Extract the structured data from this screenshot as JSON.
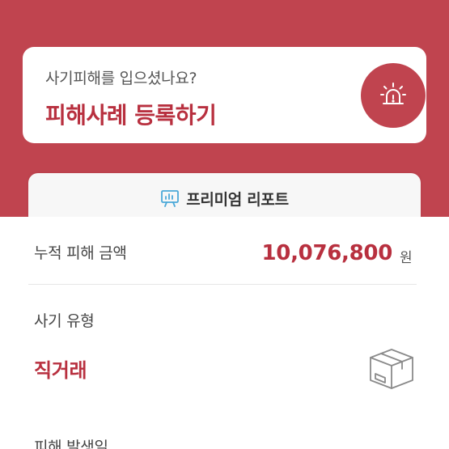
{
  "report": {
    "question": "사기피해를 입으셨나요?",
    "cta": "피해사례 등록하기",
    "icon": "siren-icon"
  },
  "premium": {
    "label": "프리미엄 리포트",
    "icon": "presentation-chart-icon"
  },
  "damage": {
    "label": "누적 피해 금액",
    "amount": "10,076,800",
    "unit": "원"
  },
  "fraud_type": {
    "label": "사기 유형",
    "value": "직거래",
    "icon": "package-box-icon"
  },
  "occurrence": {
    "label": "피해 발생일"
  },
  "colors": {
    "brand_red": "#c0444f",
    "accent_text_red": "#b8303f",
    "premium_icon": "#4aa8d8"
  }
}
